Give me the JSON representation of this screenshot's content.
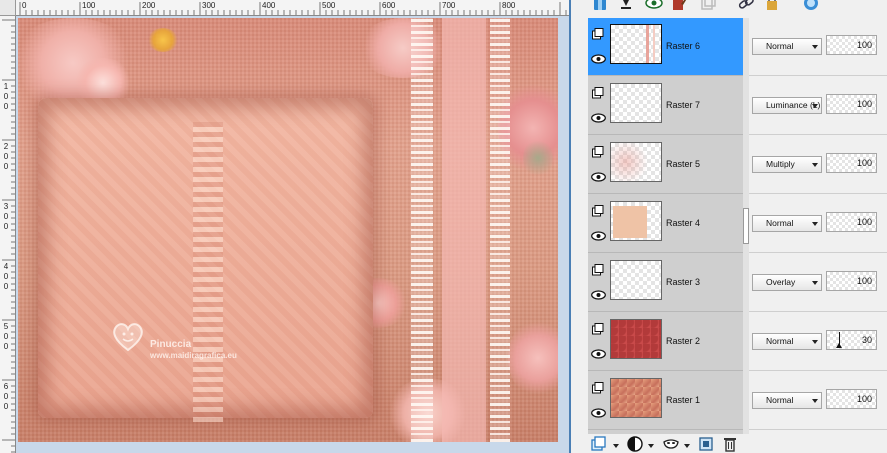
{
  "ruler": {
    "top_labels": [
      "0",
      "100",
      "200",
      "300",
      "400",
      "500",
      "600",
      "700",
      "800"
    ],
    "left_labels": [
      {
        "t": "1",
        "b": "0",
        "c": "0"
      },
      {
        "t": "2",
        "b": "0",
        "c": "0"
      },
      {
        "t": "3",
        "b": "0",
        "c": "0"
      },
      {
        "t": "4",
        "b": "0",
        "c": "0"
      },
      {
        "t": "5",
        "b": "0",
        "c": "0"
      },
      {
        "t": "6",
        "b": "0",
        "c": "0"
      }
    ]
  },
  "canvas": {
    "watermark_title": "Pinuccia",
    "watermark_url": "www.maidiragrafica.eu"
  },
  "toolbar_icons": [
    "layer-properties-icon",
    "merge-down-icon",
    "visibility-icon",
    "edit-brush-icon",
    "new-layer-icon",
    "link-icon",
    "lock-icon"
  ],
  "layers": [
    {
      "name": "Raster 6",
      "blend": "Normal",
      "opacity": "100",
      "selected": true,
      "thumb": "raster6"
    },
    {
      "name": "Raster 7",
      "blend": "Luminance (L)",
      "opacity": "100",
      "selected": false,
      "thumb": "empty"
    },
    {
      "name": "Raster 5",
      "blend": "Multiply",
      "opacity": "100",
      "selected": false,
      "thumb": "raster5"
    },
    {
      "name": "Raster 4",
      "blend": "Normal",
      "opacity": "100",
      "selected": false,
      "thumb": "raster4"
    },
    {
      "name": "Raster 3",
      "blend": "Overlay",
      "opacity": "100",
      "selected": false,
      "thumb": "empty"
    },
    {
      "name": "Raster 2",
      "blend": "Normal",
      "opacity": "30",
      "selected": false,
      "thumb": "raster2"
    },
    {
      "name": "Raster 1",
      "blend": "Normal",
      "opacity": "100",
      "selected": false,
      "thumb": "raster1"
    }
  ],
  "bottom_icons": [
    "new-raster-layer-icon",
    "adjustment-layer-icon",
    "mask-icon",
    "layer-group-icon",
    "delete-layer-icon"
  ],
  "colors": {
    "selection": "#3399ff",
    "panel": "#cfcfcf",
    "window_border": "#4a7fb5"
  }
}
